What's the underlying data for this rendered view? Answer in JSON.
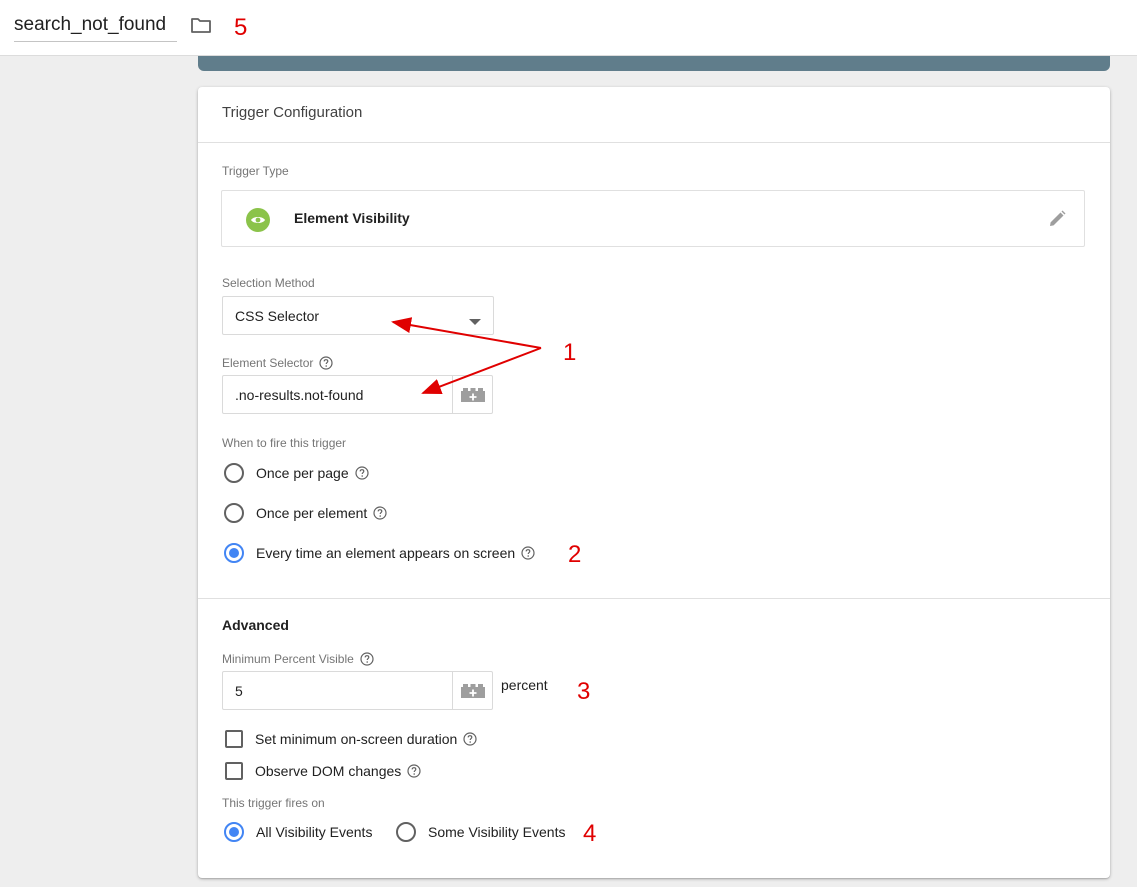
{
  "header": {
    "trigger_name": "search_not_found",
    "folder_icon": "folder-icon"
  },
  "annotations": {
    "five": "5",
    "one": "1",
    "two": "2",
    "three": "3",
    "four": "4",
    "color": "#e00000"
  },
  "card": {
    "title": "Trigger Configuration",
    "trigger_type": {
      "label": "Trigger Type",
      "name": "Element Visibility",
      "icon": "eye-icon",
      "icon_color": "#8bc34a",
      "edit_icon": "pencil-icon"
    },
    "selection_method": {
      "label": "Selection Method",
      "value": "CSS Selector"
    },
    "element_selector": {
      "label": "Element Selector",
      "value": ".no-results.not-found"
    },
    "when_to_fire": {
      "label": "When to fire this trigger",
      "options": [
        {
          "label": "Once per page",
          "checked": false
        },
        {
          "label": "Once per element",
          "checked": false
        },
        {
          "label": "Every time an element appears on screen",
          "checked": true
        }
      ]
    },
    "advanced": {
      "title": "Advanced",
      "min_percent": {
        "label": "Minimum Percent Visible",
        "value": "5",
        "unit": "percent"
      },
      "checkboxes": [
        {
          "label": "Set minimum on-screen duration",
          "checked": false
        },
        {
          "label": "Observe DOM changes",
          "checked": false
        }
      ],
      "fires_on": {
        "label": "This trigger fires on",
        "options": [
          {
            "label": "All Visibility Events",
            "checked": true
          },
          {
            "label": "Some Visibility Events",
            "checked": false
          }
        ]
      }
    }
  },
  "accent_color": "#4285f4",
  "header_strip_color": "#607d8b"
}
